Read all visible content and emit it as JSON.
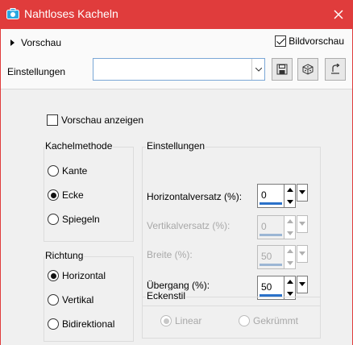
{
  "window": {
    "title": "Nahtloses Kacheln",
    "accent_color": "#e03c3c",
    "close_icon": "close-icon"
  },
  "top": {
    "preview_toggle_label": "Vorschau",
    "bildvorschau_label": "Bildvorschau",
    "bildvorschau_checked": true,
    "settings_label": "Einstellungen",
    "settings_value": "",
    "tool_icons": [
      "save-icon",
      "cube-icon",
      "reset-icon"
    ]
  },
  "options": {
    "vorschau_anzeigen_label": "Vorschau anzeigen",
    "vorschau_anzeigen_checked": false
  },
  "kachelmethode": {
    "legend": "Kachelmethode",
    "options": [
      {
        "label": "Kante",
        "checked": false
      },
      {
        "label": "Ecke",
        "checked": true
      },
      {
        "label": "Spiegeln",
        "checked": false
      }
    ]
  },
  "richtung": {
    "legend": "Richtung",
    "options": [
      {
        "label": "Horizontal",
        "checked": true
      },
      {
        "label": "Vertikal",
        "checked": false
      },
      {
        "label": "Bidirektional",
        "checked": false
      }
    ]
  },
  "einstellungen": {
    "legend": "Einstellungen",
    "params": [
      {
        "label": "Horizontalversatz (%):",
        "value": "0",
        "enabled": true
      },
      {
        "label": "Vertikalversatz (%):",
        "value": "0",
        "enabled": false
      },
      {
        "label": "Breite (%):",
        "value": "50",
        "enabled": false
      },
      {
        "label": "Übergang (%):",
        "value": "50",
        "enabled": true
      }
    ]
  },
  "eckenstil": {
    "legend": "Eckenstil",
    "options": [
      {
        "label": "Linear",
        "checked": true,
        "enabled": false
      },
      {
        "label": "Gekrümmt",
        "checked": false,
        "enabled": false
      }
    ]
  }
}
